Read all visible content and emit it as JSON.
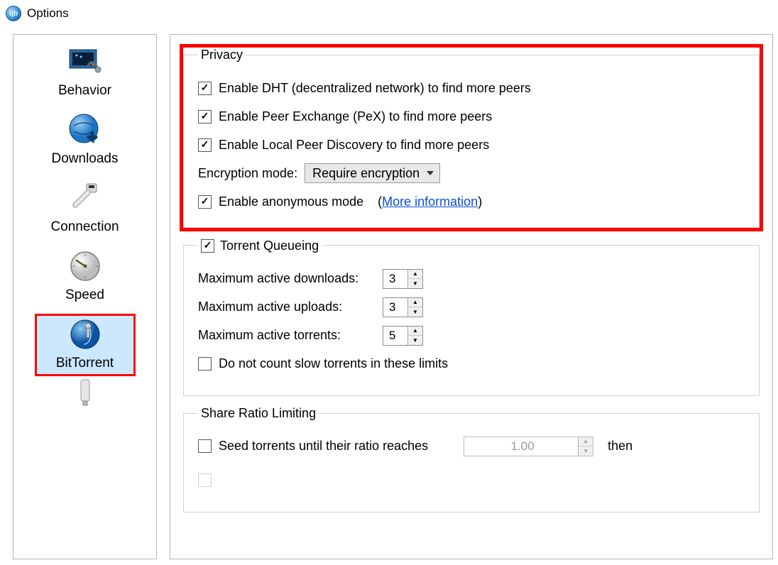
{
  "window": {
    "title": "Options"
  },
  "sidebar": {
    "items": [
      {
        "label": "Behavior"
      },
      {
        "label": "Downloads"
      },
      {
        "label": "Connection"
      },
      {
        "label": "Speed"
      },
      {
        "label": "BitTorrent"
      }
    ]
  },
  "privacy": {
    "legend": "Privacy",
    "dht": "Enable DHT (decentralized network) to find more peers",
    "pex": "Enable Peer Exchange (PeX) to find more peers",
    "lpd": "Enable Local Peer Discovery to find more peers",
    "enc_label": "Encryption mode:",
    "enc_value": "Require encryption",
    "anon": "Enable anonymous mode",
    "more_info": "More information"
  },
  "queueing": {
    "legend": "Torrent Queueing",
    "max_dl_label": "Maximum active downloads:",
    "max_dl_value": "3",
    "max_ul_label": "Maximum active uploads:",
    "max_ul_value": "3",
    "max_t_label": "Maximum active torrents:",
    "max_t_value": "5",
    "slow": "Do not count slow torrents in these limits"
  },
  "share": {
    "legend": "Share Ratio Limiting",
    "seed_until": "Seed torrents until their ratio reaches",
    "ratio_value": "1.00",
    "then": "then"
  }
}
